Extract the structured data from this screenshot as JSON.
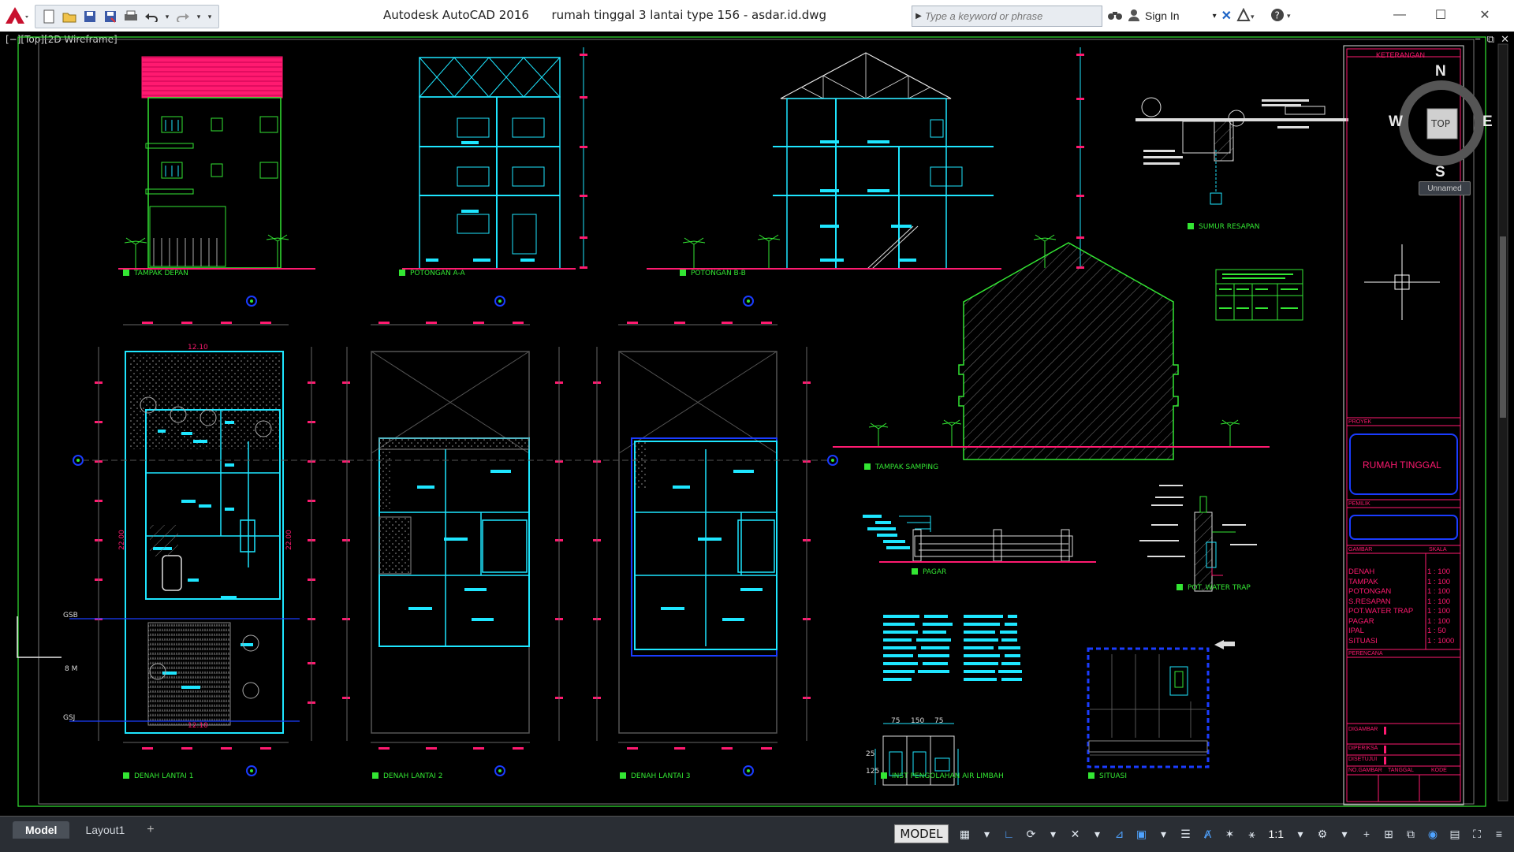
{
  "app": {
    "title_app": "Autodesk AutoCAD 2016",
    "title_file": "rumah tinggal 3 lantai type 156 - asdar.id.dwg",
    "search_placeholder": "Type a keyword or phrase",
    "sign_in": "Sign In"
  },
  "viewport": {
    "label": "[−][Top][2D Wireframe]",
    "controls": [
      "−",
      "⧉",
      "✕"
    ]
  },
  "navcube": {
    "north": "N",
    "south": "S",
    "east": "E",
    "west": "W",
    "face": "TOP",
    "ucs_label": "Unnamed"
  },
  "drawing_labels": {
    "tampak_depan": "TAMPAK DEPAN",
    "potongan_aa": "POTONGAN A-A",
    "potongan_bb": "POTONGAN B-B",
    "sumur_resapan": "SUMUR RESAPAN",
    "tampak_samping": "TAMPAK SAMPING",
    "pagar": "PAGAR",
    "pot_water_trap": "POT. WATER TRAP",
    "denah_lantai_1": "DENAH LANTAI 1",
    "denah_lantai_2": "DENAH LANTAI 2",
    "denah_lantai_3": "DENAH LANTAI 3",
    "ipal": "INST PENGOLAHAN AIR LIMBAH",
    "situasi": "SITUASI",
    "gsb": "GSB",
    "gsj": "GSJ",
    "dim_8m": "8 M",
    "dim_12": "12.10",
    "dim_22": "22.00",
    "dim_75a": "75",
    "dim_150": "150",
    "dim_75b": "75",
    "dim_125": "125",
    "dim_25": "25"
  },
  "title_block": {
    "keterangan": "KETERANGAN",
    "proyek": "PROYEK",
    "proyek_name": "RUMAH TINGGAL",
    "pemilik": "PEMILIK",
    "gambar": "GAMBAR",
    "skala": "SKALA",
    "sheets": [
      {
        "name": "DENAH",
        "scale": "1 : 100"
      },
      {
        "name": "TAMPAK",
        "scale": "1 : 100"
      },
      {
        "name": "POTONGAN",
        "scale": "1 : 100"
      },
      {
        "name": "S.RESAPAN",
        "scale": "1 : 100"
      },
      {
        "name": "POT.WATER TRAP",
        "scale": "1 : 100"
      },
      {
        "name": "PAGAR",
        "scale": "1 : 100"
      },
      {
        "name": "IPAL",
        "scale": "1 : 50"
      },
      {
        "name": "SITUASI",
        "scale": "1 : 1000"
      }
    ],
    "perencana": "PERENCANA",
    "digambar": "DIGAMBAR",
    "diperiksa": "DIPERIKSA",
    "disetujui": "DISETUJUI",
    "no_gambar": "NO.GAMBAR",
    "tanggal": "TANGGAL",
    "kode": "KODE"
  },
  "status": {
    "tabs": [
      "Model",
      "Layout1"
    ],
    "model_button": "MODEL",
    "scale": "1:1"
  },
  "colors": {
    "magenta": "#ff1a70",
    "cyan": "#1ee6ff",
    "green": "#33e633",
    "white": "#ffffff",
    "gray": "#8a8a8a"
  }
}
